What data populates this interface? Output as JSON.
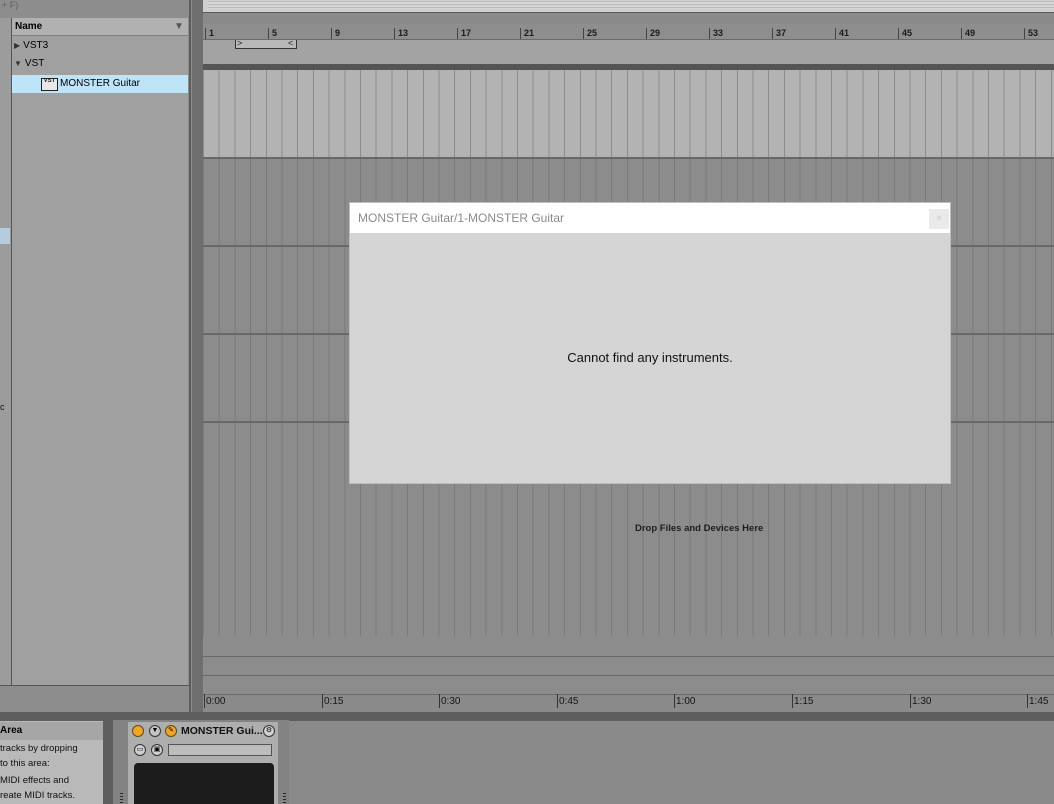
{
  "browser": {
    "top_hint": "+ F)",
    "column_header": "Name",
    "sort_icon": "▼",
    "places_partial_letter": "c",
    "items": [
      {
        "label": "VST3",
        "expanded": false
      },
      {
        "label": "VST",
        "expanded": true
      },
      {
        "label": "MONSTER Guitar",
        "selected": true,
        "icon": "vst-plugin-icon"
      }
    ],
    "vst_icon_text": "VST"
  },
  "arrangement": {
    "bar_numbers": [
      "1",
      "5",
      "9",
      "13",
      "17",
      "21",
      "25",
      "29",
      "33",
      "37",
      "41",
      "45",
      "49",
      "53"
    ],
    "drop_hint": "Drop Files and Devices Here",
    "time_labels": [
      "0:00",
      "0:15",
      "0:30",
      "0:45",
      "1:00",
      "1:15",
      "1:30",
      "1:45"
    ]
  },
  "dialog": {
    "title": "MONSTER Guitar/1-MONSTER Guitar",
    "message": "Cannot find any instruments.",
    "close_glyph": "×"
  },
  "info_view": {
    "title": "Area",
    "lines": [
      "tracks by dropping",
      "to this area:",
      "MIDI effects and",
      "reate MIDI tracks."
    ]
  },
  "device": {
    "name": "MONSTER Gui...",
    "colors": {
      "power": "#f0a52a",
      "screen": "#1c1c1c"
    }
  },
  "colors": {
    "selection": "#bfe3f7",
    "dialog_bg": "#d5d5d5",
    "dialog_title_text": "#8a8a8a"
  }
}
